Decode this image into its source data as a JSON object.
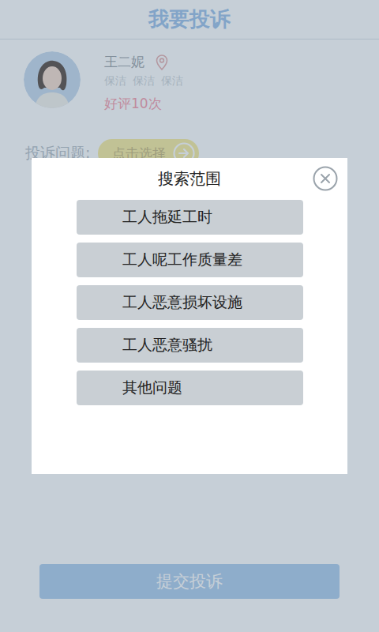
{
  "header": {
    "title": "我要投诉"
  },
  "worker": {
    "name": "王二妮",
    "tags": [
      "保洁",
      "保洁",
      "保洁"
    ],
    "rating": "好评10次"
  },
  "complaint": {
    "label": "投诉问题:",
    "picker": "点击选择"
  },
  "submit": "提交投诉",
  "modal": {
    "title": "搜索范围",
    "options": [
      {
        "label": "工人拖延工时",
        "selected": false
      },
      {
        "label": "工人呢工作质量差",
        "selected": false
      },
      {
        "label": "工人恶意损坏设施",
        "selected": false
      },
      {
        "label": "工人恶意骚扰",
        "selected": false
      },
      {
        "label": "其他问题",
        "selected": false
      }
    ]
  }
}
